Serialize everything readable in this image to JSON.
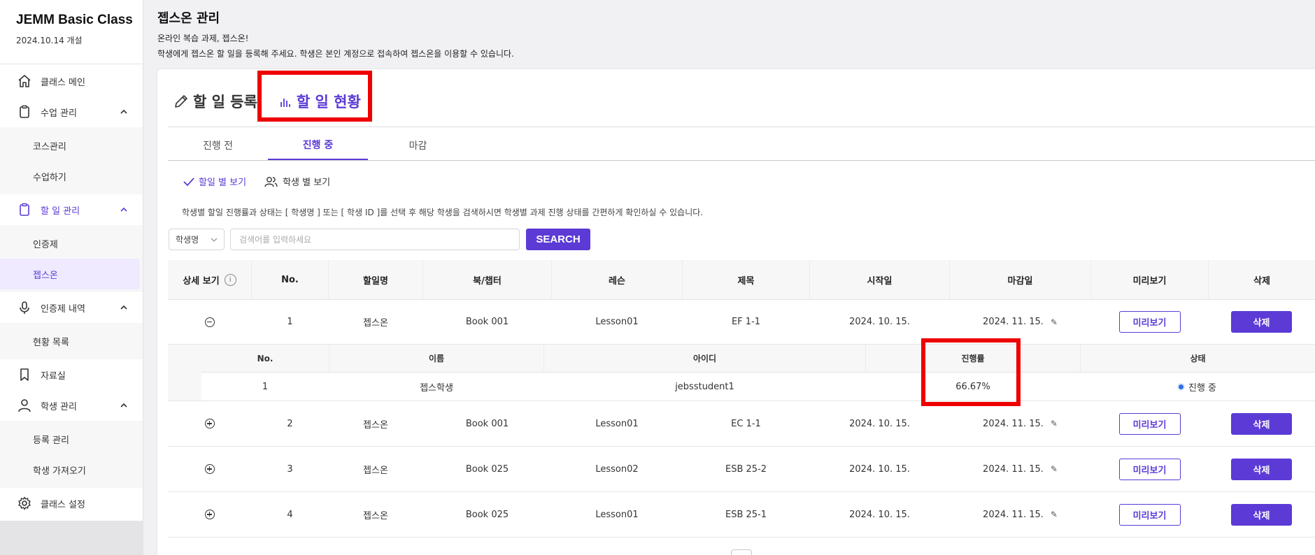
{
  "sidebar": {
    "class_title": "JEMM Basic Class",
    "class_date": "2024.10.14 개설",
    "menu": {
      "class_main": "클래스 메인",
      "lesson_mgmt": "수업 관리",
      "course_mgmt": "코스관리",
      "take_lesson": "수업하기",
      "todo_mgmt": "할 일 관리",
      "certification": "인증제",
      "jebsone": "젭스온",
      "cert_history": "인증제 내역",
      "status_list": "현황 목록",
      "resources": "자료실",
      "student_mgmt": "학생 관리",
      "registration": "등록 관리",
      "import_students": "학생 가져오기",
      "class_settings": "클래스 설정"
    }
  },
  "header": {
    "title": "젭스온 관리",
    "subtitle1": "온라인 복습 과제, 젭스온!",
    "subtitle2": "학생에게 젭스온 할 일을 등록해 주세요. 학생은 본인 계정으로 접속하여 젭스온을 이용할 수 있습니다."
  },
  "mode_tabs": {
    "register": "할 일 등록",
    "status": "할 일 현황"
  },
  "status_tabs": {
    "before": "진행 전",
    "in_progress": "진행 중",
    "closed": "마감"
  },
  "view_toggle": {
    "by_todo": "할일 별 보기",
    "by_student": "학생 별 보기"
  },
  "help_text": "학생별 할일 진행률과 상태는 [ 학생명 ] 또는 [ 학생 ID ]를 선택 후 해당 학생을 검색하시면 학생별 과제 진행 상태를 간편하게 확인하실 수 있습니다.",
  "search": {
    "select_value": "학생명",
    "placeholder": "검색어를 입력하세요",
    "button": "SEARCH"
  },
  "table": {
    "headers": {
      "detail": "상세 보기",
      "no": "No.",
      "todo_name": "할일명",
      "book": "북/챕터",
      "lesson": "레슨",
      "title": "제목",
      "start": "시작일",
      "due": "마감일",
      "preview": "미리보기",
      "delete": "삭제"
    },
    "preview_label": "미리보기",
    "delete_label": "삭제",
    "rows": [
      {
        "no": "1",
        "todo_name": "젭스온",
        "book": "Book 001",
        "lesson": "Lesson01",
        "title": "EF 1-1",
        "start": "2024. 10. 15.",
        "due": "2024. 11. 15."
      },
      {
        "no": "2",
        "todo_name": "젭스온",
        "book": "Book 001",
        "lesson": "Lesson01",
        "title": "EC 1-1",
        "start": "2024. 10. 15.",
        "due": "2024. 11. 15."
      },
      {
        "no": "3",
        "todo_name": "젭스온",
        "book": "Book 025",
        "lesson": "Lesson02",
        "title": "ESB 25-2",
        "start": "2024. 10. 15.",
        "due": "2024. 11. 15."
      },
      {
        "no": "4",
        "todo_name": "젭스온",
        "book": "Book 025",
        "lesson": "Lesson01",
        "title": "ESB 25-1",
        "start": "2024. 10. 15.",
        "due": "2024. 11. 15."
      }
    ],
    "detail": {
      "headers": {
        "no": "No.",
        "name": "이름",
        "id": "아이디",
        "progress": "진행률",
        "status": "상태"
      },
      "rows": [
        {
          "no": "1",
          "name": "젭스학생",
          "id": "jebsstudent1",
          "progress": "66.67%",
          "status": "진행 중"
        }
      ]
    }
  },
  "colors": {
    "accent": "#5b3ad6",
    "highlight": "#ee0000",
    "status_dot": "#2f6ee8"
  }
}
